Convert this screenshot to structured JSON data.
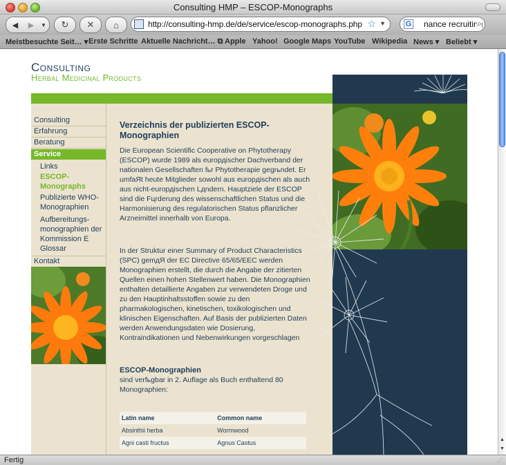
{
  "window": {
    "title": "Consulting HMP – ESCOP-Monographs"
  },
  "toolbar": {
    "url": "http://consulting-hmp.de/de/service/escop-monographs.php",
    "search_value": "nance recruiting",
    "search_engine_icon": "G"
  },
  "bookmarks": [
    {
      "label": "Meistbesuchte Seit… ▾"
    },
    {
      "label": "Erste Schritte"
    },
    {
      "label": "Aktuelle Nachricht… ⧉"
    },
    {
      "label": "Apple"
    },
    {
      "label": "Yahoo!"
    },
    {
      "label": "Google Maps"
    },
    {
      "label": "YouTube"
    },
    {
      "label": "Wikipedia"
    },
    {
      "label": "News ▾"
    },
    {
      "label": "Beliebt ▾"
    }
  ],
  "site": {
    "brand_line1": "Consulting",
    "brand_line2": "Herbal Medicinal Products"
  },
  "nav": {
    "items": [
      {
        "label": "Consulting"
      },
      {
        "label": "Erfahrung"
      },
      {
        "label": "Beratung"
      },
      {
        "label": "Service"
      },
      {
        "label": "Kontakt"
      }
    ],
    "service_sub": [
      {
        "label": "Links"
      },
      {
        "label": "ESCOP-Monographs"
      },
      {
        "label": "Publizierte WHO-Monographien"
      },
      {
        "label": "Aufbereitungs-monographien der Kommission E"
      },
      {
        "label": "Glossar"
      }
    ]
  },
  "article": {
    "heading": "Verzeichnis der publizierten ESCOP-Monographien",
    "para1": "Die European Scientific Cooperative on Phytotherapy (ESCOP) wurde 1989 als europдischer Dachverband der nationalen Gesellschaften fьr Phytotherapie gegrьndet. Er umfaЯt heute Mitglieder sowohl aus europдischen als auch aus nicht-europдischen Lдndern. Hauptziele der ESCOP sind die Fцrderung des wissenschaftlichen Status und die Harmonisierung des regulatorischen Status pflanzlicher Arzneimittel innerhalb von Europa.",
    "para2": "In der Struktur einer Summary of Product Characteristics (SPC) gemдЯ der EC Directive 65/65/EEC werden Monographien erstellt, die durch die Angabe der zitierten Quellen einen hohen Stellenwert haben. Die Monographien enthalten detaillierte Angaben zur verwendeten Droge und zu den Hauptinhaltsstoffen sowie zu den pharmakologischen, kinetischen, toxikologischen und klinischen Eigenschaften. Auf Basis der publizierten Daten werden Anwendungsdaten wie Dosierung, Kontraindikationen und Nebenwirkungen vorgeschlagen",
    "subheading": "ESCOP-Monographien",
    "para3": "sind verfьgbar in 2. Auflage als Buch enthaltend 80 Monographien:"
  },
  "table": {
    "headers": [
      "Latin name",
      "Common name"
    ],
    "rows": [
      [
        "Absinthii herba",
        "Wormwood"
      ],
      [
        "Agni casti fructus",
        "Agnus Castus"
      ]
    ]
  },
  "status": {
    "text": "Fertig"
  }
}
